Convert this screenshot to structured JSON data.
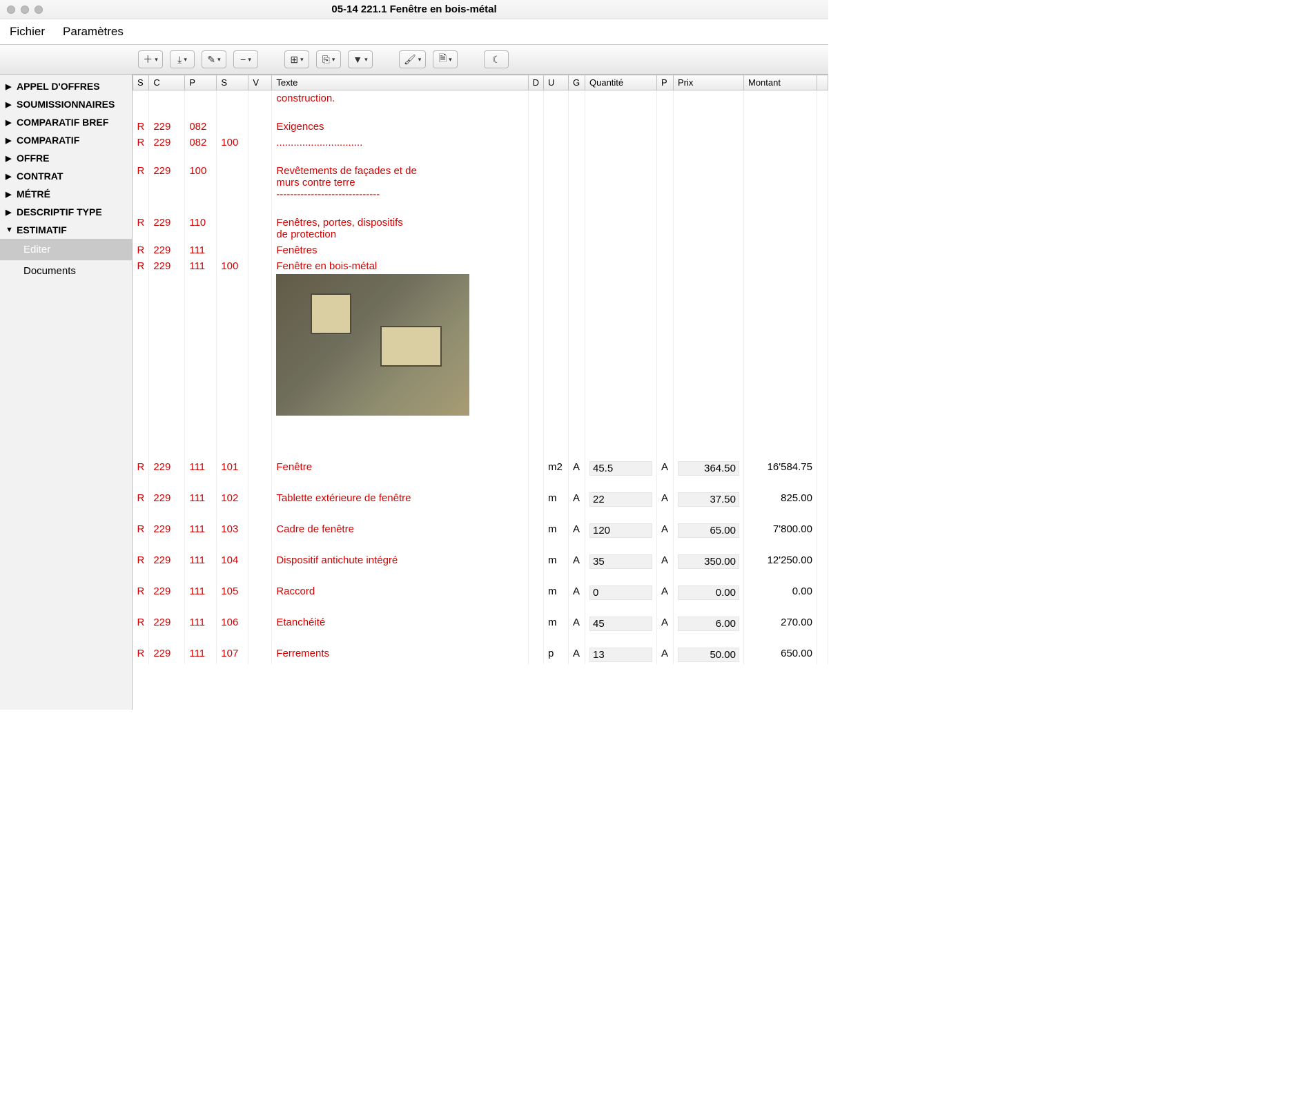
{
  "window": {
    "title": "05-14 221.1 Fenêtre en bois-métal"
  },
  "menu": {
    "file": "Fichier",
    "params": "Paramètres"
  },
  "sidebar": {
    "items": [
      {
        "label": "APPEL D'OFFRES",
        "expanded": false
      },
      {
        "label": "SOUMISSIONNAIRES",
        "expanded": false
      },
      {
        "label": "COMPARATIF BREF",
        "expanded": false
      },
      {
        "label": "COMPARATIF",
        "expanded": false
      },
      {
        "label": "OFFRE",
        "expanded": false
      },
      {
        "label": "CONTRAT",
        "expanded": false
      },
      {
        "label": "MÉTRÉ",
        "expanded": false
      },
      {
        "label": "DESCRIPTIF TYPE",
        "expanded": false
      },
      {
        "label": "ESTIMATIF",
        "expanded": true
      }
    ],
    "subs": [
      {
        "label": "Editer",
        "selected": true
      },
      {
        "label": "Documents",
        "selected": false
      }
    ]
  },
  "columns": {
    "S1": "S",
    "C": "C",
    "P1": "P",
    "S2": "S",
    "V": "V",
    "Texte": "Texte",
    "D": "D",
    "U": "U",
    "G": "G",
    "Q": "Quantité",
    "P2": "P",
    "Prix": "Prix",
    "M": "Montant"
  },
  "rows": [
    {
      "s": "",
      "c": "",
      "p": "",
      "s2": "",
      "v": "",
      "texte": "construction.",
      "u": "",
      "g": "",
      "q": "",
      "p2": "",
      "prix": "",
      "m": ""
    },
    {
      "blank": true
    },
    {
      "s": "R",
      "c": "229",
      "p": "082",
      "s2": "",
      "v": "",
      "texte": "Exigences",
      "u": "",
      "g": "",
      "q": "",
      "p2": "",
      "prix": "",
      "m": ""
    },
    {
      "s": "R",
      "c": "229",
      "p": "082",
      "s2": "100",
      "v": "",
      "texte": "..............................",
      "u": "",
      "g": "",
      "q": "",
      "p2": "",
      "prix": "",
      "m": ""
    },
    {
      "blank": true
    },
    {
      "s": "R",
      "c": "229",
      "p": "100",
      "s2": "",
      "v": "",
      "texte": "Revêtements de façades et de\nmurs contre terre\n------------------------------",
      "u": "",
      "g": "",
      "q": "",
      "p2": "",
      "prix": "",
      "m": ""
    },
    {
      "blank": true
    },
    {
      "s": "R",
      "c": "229",
      "p": "110",
      "s2": "",
      "v": "",
      "texte": "Fenêtres, portes, dispositifs\nde protection",
      "u": "",
      "g": "",
      "q": "",
      "p2": "",
      "prix": "",
      "m": ""
    },
    {
      "s": "R",
      "c": "229",
      "p": "111",
      "s2": "",
      "v": "",
      "texte": "Fenêtres",
      "u": "",
      "g": "",
      "q": "",
      "p2": "",
      "prix": "",
      "m": ""
    },
    {
      "s": "R",
      "c": "229",
      "p": "111",
      "s2": "100",
      "v": "",
      "texte": "Fenêtre en bois-métal",
      "img": true,
      "u": "",
      "g": "",
      "q": "",
      "p2": "",
      "prix": "",
      "m": ""
    },
    {
      "blank": true,
      "tall": true
    },
    {
      "s": "R",
      "c": "229",
      "p": "111",
      "s2": "101",
      "v": "",
      "texte": "Fenêtre",
      "u": "m2",
      "g": "A",
      "q": "45.5",
      "p2": "A",
      "prix": "364.50",
      "m": "16'584.75"
    },
    {
      "blank": true
    },
    {
      "s": "R",
      "c": "229",
      "p": "111",
      "s2": "102",
      "v": "",
      "texte": "Tablette extérieure de fenêtre",
      "u": "m",
      "g": "A",
      "q": "22",
      "p2": "A",
      "prix": "37.50",
      "m": "825.00"
    },
    {
      "blank": true
    },
    {
      "s": "R",
      "c": "229",
      "p": "111",
      "s2": "103",
      "v": "",
      "texte": "Cadre de fenêtre",
      "u": "m",
      "g": "A",
      "q": "120",
      "p2": "A",
      "prix": "65.00",
      "m": "7'800.00"
    },
    {
      "blank": true
    },
    {
      "s": "R",
      "c": "229",
      "p": "111",
      "s2": "104",
      "v": "",
      "texte": "Dispositif antichute intégré",
      "u": "m",
      "g": "A",
      "q": "35",
      "p2": "A",
      "prix": "350.00",
      "m": "12'250.00"
    },
    {
      "blank": true
    },
    {
      "s": "R",
      "c": "229",
      "p": "111",
      "s2": "105",
      "v": "",
      "texte": "Raccord",
      "u": "m",
      "g": "A",
      "q": "0",
      "p2": "A",
      "prix": "0.00",
      "m": "0.00"
    },
    {
      "blank": true
    },
    {
      "s": "R",
      "c": "229",
      "p": "111",
      "s2": "106",
      "v": "",
      "texte": "Etanchéité",
      "u": "m",
      "g": "A",
      "q": "45",
      "p2": "A",
      "prix": "6.00",
      "m": "270.00"
    },
    {
      "blank": true
    },
    {
      "s": "R",
      "c": "229",
      "p": "111",
      "s2": "107",
      "v": "",
      "texte": "Ferrements",
      "u": "p",
      "g": "A",
      "q": "13",
      "p2": "A",
      "prix": "50.00",
      "m": "650.00"
    }
  ],
  "icons": {
    "add": "＋",
    "download": "⤓",
    "edit": "✎",
    "remove": "−",
    "table": "⊞",
    "export": "⎘",
    "filter": "▼",
    "brush": "🖌",
    "page": "🗎",
    "moon": "☾"
  }
}
